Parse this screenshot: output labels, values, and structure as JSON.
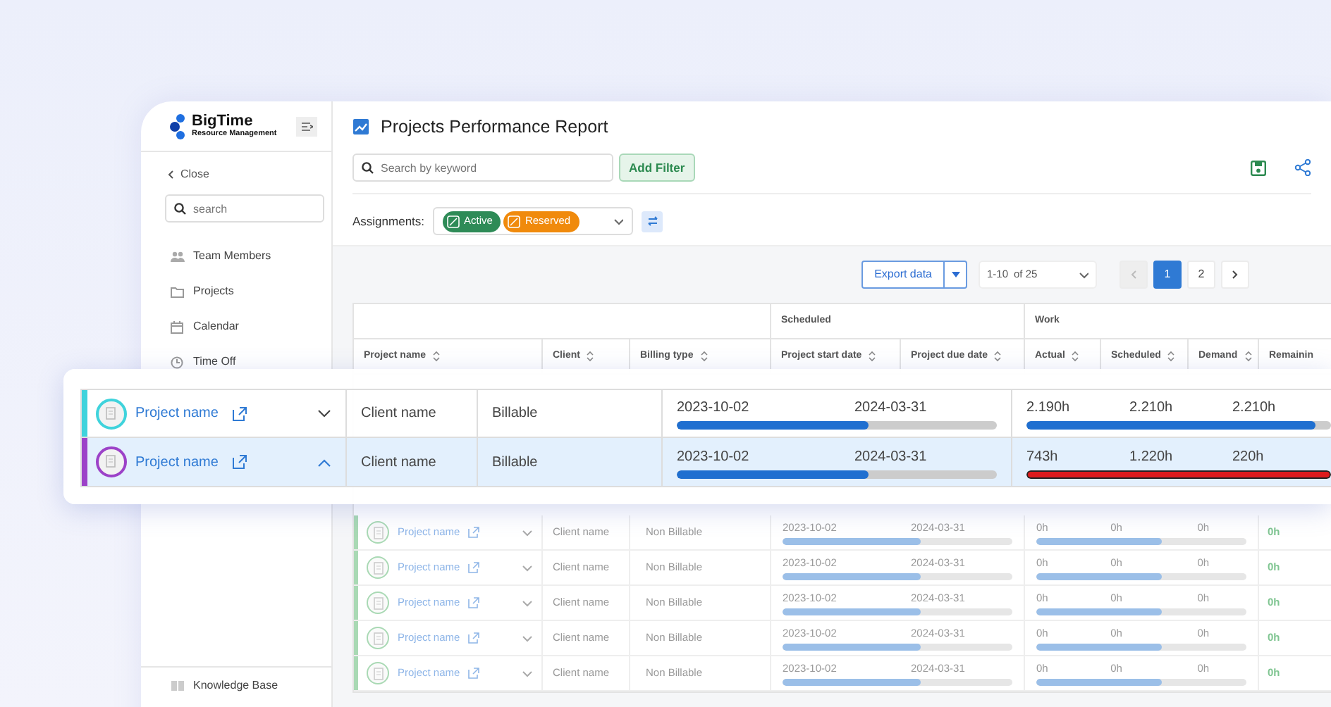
{
  "sidebar": {
    "brand": "BigTime",
    "brand_subtitle": "Resource Management",
    "close": "Close",
    "search_placeholder": "search",
    "items": [
      {
        "label": "Team Members"
      },
      {
        "label": "Projects"
      },
      {
        "label": "Calendar"
      },
      {
        "label": "Time Off"
      }
    ],
    "footer_items": [
      {
        "label": "Knowledge Base"
      }
    ]
  },
  "header": {
    "title": "Projects Performance Report",
    "search_placeholder": "Search by keyword",
    "add_filter": "Add Filter"
  },
  "assignments": {
    "label": "Assignments:",
    "tags": [
      {
        "label": "Active",
        "color": "#2e8b57"
      },
      {
        "label": "Reserved",
        "color": "#f08a0c"
      }
    ]
  },
  "toolbar": {
    "export": "Export data",
    "page_size": "1-10",
    "total": "of 25",
    "prev_disabled": true,
    "pages": [
      {
        "label": "1",
        "selected": true
      },
      {
        "label": "2",
        "selected": false
      }
    ]
  },
  "table": {
    "groups": [
      "Scheduled",
      "Work"
    ],
    "columns": [
      "Project name",
      "Client",
      "Billing type",
      "Project start date",
      "Project due date",
      "Actual",
      "Scheduled",
      "Demand",
      "Remainin"
    ],
    "rows": [
      {
        "project": "Project name",
        "client": "Client name",
        "billing": "Non Billable",
        "start": "2023-10-02",
        "due": "2024-03-31",
        "schedule_bar": {
          "level": 0.6
        },
        "actual": "0h",
        "scheduled": "0h",
        "demand": "0h",
        "work_bar": {
          "level": 0.6
        },
        "remaining": "0h"
      },
      {
        "project": "Project name",
        "client": "Client name",
        "billing": "Non Billable",
        "start": "2023-10-02",
        "due": "2024-03-31",
        "schedule_bar": {
          "level": 0.6
        },
        "actual": "0h",
        "scheduled": "0h",
        "demand": "0h",
        "work_bar": {
          "level": 0.6
        },
        "remaining": "0h"
      },
      {
        "project": "Project name",
        "client": "Client name",
        "billing": "Non Billable",
        "start": "2023-10-02",
        "due": "2024-03-31",
        "schedule_bar": {
          "level": 0.6
        },
        "actual": "0h",
        "scheduled": "0h",
        "demand": "0h",
        "work_bar": {
          "level": 0.6
        },
        "remaining": "0h"
      },
      {
        "project": "Project name",
        "client": "Client name",
        "billing": "Non Billable",
        "start": "2023-10-02",
        "due": "2024-03-31",
        "schedule_bar": {
          "level": 0.6
        },
        "actual": "0h",
        "scheduled": "0h",
        "demand": "0h",
        "work_bar": {
          "level": 0.6
        },
        "remaining": "0h"
      },
      {
        "project": "Project name",
        "client": "Client name",
        "billing": "Non Billable",
        "start": "2023-10-02",
        "due": "2024-03-31",
        "schedule_bar": {
          "level": 0.6
        },
        "actual": "0h",
        "scheduled": "0h",
        "demand": "0h",
        "work_bar": {
          "level": 0.6
        },
        "remaining": "0h"
      }
    ]
  },
  "highlighted_rows": [
    {
      "project": "Project name",
      "client": "Client name",
      "billing": "Billable",
      "start": "2023-10-02",
      "due": "2024-03-31",
      "schedule_bar": {
        "level": 0.6
      },
      "actual": "2.190h",
      "scheduled": "2.210h",
      "demand": "2.210h",
      "work_bar": {
        "level": 0.95
      },
      "kind": "normal",
      "color": "#3fd3dc",
      "expanded": false,
      "selected": false
    },
    {
      "project": "Project name",
      "client": "Client name",
      "billing": "Billable",
      "start": "2023-10-02",
      "due": "2024-03-31",
      "schedule_bar": {
        "level": 0.6
      },
      "actual": "743h",
      "scheduled": "1.220h",
      "demand": "220h",
      "work_bar": {
        "level": 1
      },
      "kind": "over",
      "color": "#9c42c8",
      "expanded": true,
      "selected": true
    }
  ]
}
